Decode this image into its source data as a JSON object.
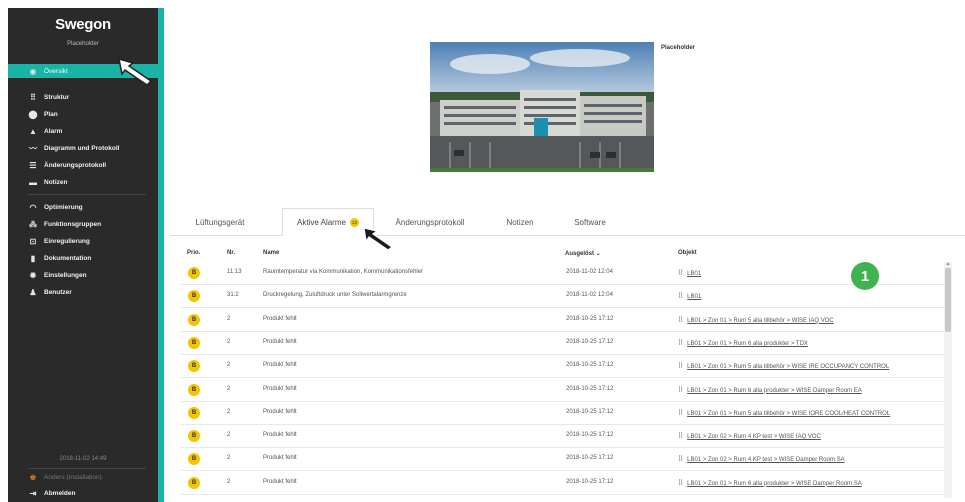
{
  "sidebar": {
    "logo": "Swegon",
    "logo_sub": "Placeholder",
    "active_item": {
      "label": "Översikt",
      "icon": "eye-icon"
    },
    "items": [
      {
        "label": "Struktur",
        "icon": "structure-icon"
      },
      {
        "label": "Plan",
        "icon": "location-pin-icon"
      },
      {
        "label": "Alarm",
        "icon": "bell-icon"
      },
      {
        "label": "Diagramm und Protokoll",
        "icon": "chart-icon"
      },
      {
        "label": "Änderungsprotokoll",
        "icon": "list-icon"
      },
      {
        "label": "Notizen",
        "icon": "note-icon"
      }
    ],
    "items2": [
      {
        "label": "Optimierung",
        "icon": "gauge-icon"
      },
      {
        "label": "Funktionsgruppen",
        "icon": "group-icon"
      },
      {
        "label": "Einregulierung",
        "icon": "adjust-icon"
      },
      {
        "label": "Dokumentation",
        "icon": "document-icon"
      },
      {
        "label": "Einstellungen",
        "icon": "gear-icon"
      },
      {
        "label": "Benutzer",
        "icon": "users-icon"
      }
    ],
    "datetime": "2018-11-02 14:49",
    "user": "Anders (Installation)",
    "logout": "Abmelden"
  },
  "photo": {
    "caption": "Placeholder"
  },
  "tabs": [
    {
      "label": "Lüftungsgerät",
      "active": false
    },
    {
      "label": "Aktive Alarme",
      "active": true,
      "badge": "12"
    },
    {
      "label": "Änderungsprotokoll",
      "active": false
    },
    {
      "label": "Notizen",
      "active": false
    },
    {
      "label": "Software",
      "active": false
    }
  ],
  "table": {
    "headers": {
      "prio": "Prio.",
      "nr": "Nr.",
      "name": "Name",
      "ausgeloest": "Ausgelöst ⌄",
      "objekt": "Objekt"
    },
    "rows": [
      {
        "prio": "B",
        "nr": "11:13",
        "name": "Raumtemperatur via Kommunikation, Kommunikationsfehler",
        "time": "2018-11-02 12:04",
        "objekt": "LB01"
      },
      {
        "prio": "B",
        "nr": "31:2",
        "name": "Druckregelung, Zuluftdruck unter Sollwertalarmgrenze",
        "time": "2018-11-02 12:04",
        "objekt": "LB01"
      },
      {
        "prio": "B",
        "nr": "2",
        "name": "Produkt fehlt",
        "time": "2018-10-25 17:12",
        "objekt": "LB01 > Zon 01 > Rum 5 alla tillbehör > WISE IAQ VOC"
      },
      {
        "prio": "B",
        "nr": "2",
        "name": "Produkt fehlt",
        "time": "2018-10-25 17:12",
        "objekt": "LB01 > Zon 01 > Rum 6 alla produkter > TDX"
      },
      {
        "prio": "B",
        "nr": "2",
        "name": "Produkt fehlt",
        "time": "2018-10-25 17:12",
        "objekt": "LB01 > Zon 01 > Rum 5 alla tillbehör > WISE IRE OCCUPANCY CONTROL"
      },
      {
        "prio": "B",
        "nr": "2",
        "name": "Produkt fehlt",
        "time": "2018-10-25 17:12",
        "objekt": "LB01 > Zon 01 > Rum 6 alla produkter > WISE Damper Room EA"
      },
      {
        "prio": "B",
        "nr": "2",
        "name": "Produkt fehlt",
        "time": "2018-10-25 17:12",
        "objekt": "LB01 > Zon 01 > Rum 5 alla tillbehör > WISE IORE COOL/HEAT CONTROL"
      },
      {
        "prio": "B",
        "nr": "2",
        "name": "Produkt fehlt",
        "time": "2018-10-25 17:12",
        "objekt": "LB01 > Zon 02 > Rum 4 KP test > WISE IAQ VOC"
      },
      {
        "prio": "B",
        "nr": "2",
        "name": "Produkt fehlt",
        "time": "2018-10-25 17:12",
        "objekt": "LB01 > Zon 02 > Rum 4 KP test > WISE Damper Room SA"
      },
      {
        "prio": "B",
        "nr": "2",
        "name": "Produkt fehlt",
        "time": "2018-10-25 17:12",
        "objekt": "LB01 > Zon 01 > Rum 6 alla produkter > WISE Damper Room SA"
      }
    ]
  },
  "callout": {
    "number": "1"
  },
  "colors": {
    "sidebar": "#2a2a2a",
    "accent": "#19b4a6",
    "prio_badge": "#f2c500",
    "callout": "#3fb34f"
  }
}
